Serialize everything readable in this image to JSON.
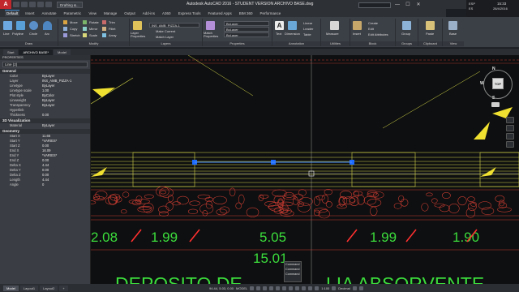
{
  "titlebar": {
    "workspace": "Drafting &...",
    "title": "Autodesk AutoCAD 2016 - STUDENT VERSION    ARCHIVO BASE.dwg",
    "search_placeholder": "",
    "user": "",
    "min": "—",
    "max": "☐",
    "close": "✕"
  },
  "ribbon_tabs": [
    "Default",
    "Insert",
    "Annotate",
    "Parametric",
    "View",
    "Manage",
    "Output",
    "Add-ins",
    "A360",
    "Express Tools",
    "Featured Apps",
    "BIM 360",
    "Performance"
  ],
  "ribbon": {
    "draw": {
      "label": "Draw",
      "line": "Line",
      "polyline": "Polyline",
      "circle": "Circle",
      "arc": "Arc"
    },
    "modify": {
      "label": "Modify",
      "items": [
        "Move",
        "Rotate",
        "Trim",
        "Copy",
        "Mirror",
        "Fillet",
        "Stretch",
        "Scale",
        "Array"
      ]
    },
    "layers": {
      "label": "Layers",
      "layer_props": "Layer Properties",
      "current": "INS_AMB_PIZZA-1",
      "make_current": "Make Current",
      "match_layer": "Match Layer"
    },
    "match": {
      "label": "Match Properties"
    },
    "properties": {
      "label": "Properties",
      "rows": [
        "ByLayer",
        "ByLayer",
        "ByLayer"
      ]
    },
    "annotation": {
      "label": "Annotation",
      "text": "Text",
      "dimension": "Dimension",
      "linear": "Linear",
      "leader": "Leader",
      "table": "Table"
    },
    "utilities": {
      "label": "Utilities",
      "measure": "Measure"
    },
    "block": {
      "label": "Block",
      "insert": "Insert",
      "create": "Create",
      "edit": "Edit",
      "edit_attr": "Edit Attributes"
    },
    "groups": {
      "label": "Groups",
      "group": "Group"
    },
    "clipboard": {
      "label": "Clipboard",
      "paste": "Paste"
    },
    "view": {
      "label": "View",
      "base": "Base"
    }
  },
  "doc_tabs": [
    "Start",
    "ARCHIVO BASE*",
    "Model"
  ],
  "properties_panel": {
    "title": "PROPERTIES",
    "selection": "Line (2)",
    "general": {
      "label": "General",
      "rows": [
        [
          "Color",
          "ByLayer"
        ],
        [
          "Layer",
          "INS_AMB_PIZZA-1"
        ],
        [
          "Linetype",
          "ByLayer"
        ],
        [
          "Linetype scale",
          "1.00"
        ],
        [
          "Plot style",
          "ByColor"
        ],
        [
          "Lineweight",
          "ByLayer"
        ],
        [
          "Transparency",
          "ByLayer"
        ],
        [
          "Hyperlink",
          ""
        ],
        [
          "Thickness",
          "0.00"
        ]
      ]
    },
    "viz": {
      "label": "3D Visualization",
      "rows": [
        [
          "Material",
          "ByLayer"
        ]
      ]
    },
    "geometry": {
      "label": "Geometry",
      "rows": [
        [
          "Start X",
          "11.65"
        ],
        [
          "Start Y",
          "*VARIES*"
        ],
        [
          "Start Z",
          "0.00"
        ],
        [
          "End X",
          "16.09"
        ],
        [
          "End Y",
          "*VARIES*"
        ],
        [
          "End Z",
          "0.00"
        ],
        [
          "Delta X",
          "4.44"
        ],
        [
          "Delta Y",
          "0.00"
        ],
        [
          "Delta Z",
          "0.00"
        ],
        [
          "Length",
          "4.44"
        ],
        [
          "Angle",
          "0"
        ]
      ]
    }
  },
  "drawing": {
    "dims_row1": [
      "2.08",
      "1.99",
      "5.05",
      "1.99",
      "1.90"
    ],
    "dims_row2": "15.01",
    "bottom_text_left": "DEPOSITO DE",
    "bottom_text_right": "LIA ABSORVENTE",
    "line_color": "#d8d84a",
    "hatch_color": "#c83c32",
    "dim_color": "#3cdc3c",
    "arrow_color": "#f0e030",
    "grip_color": "#1e6cff",
    "slash_color": "#ff3030"
  },
  "viewcube": {
    "top": "TOP",
    "n": "N",
    "s": "S",
    "e": "E",
    "w": "W"
  },
  "tooltip": {
    "items": [
      "Command",
      "Command",
      "Command"
    ]
  },
  "layout_tabs": [
    "Model",
    "Layout1",
    "Layout2",
    "+"
  ],
  "status": {
    "coords": "94.44, 5.03, 0.00",
    "mode": "MODEL",
    "scale": "1:100",
    "units": "Decimal"
  },
  "clock": {
    "lang": "ESP",
    "region": "ES",
    "time": "15:33",
    "date": "28/4/2016"
  }
}
